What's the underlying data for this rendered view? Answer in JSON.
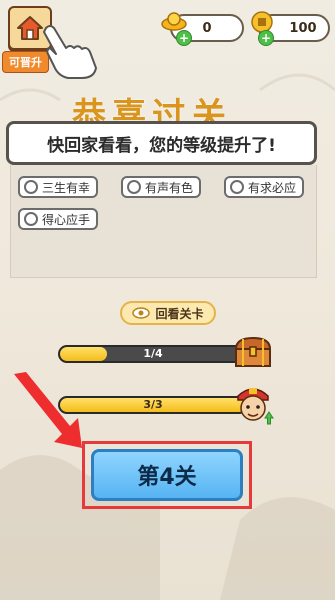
{
  "header": {
    "upgrade_badge": "可晋升",
    "currency_a": {
      "icon": "gold-ingot-icon",
      "value": "0"
    },
    "currency_b": {
      "icon": "coin-icon",
      "value": "100"
    }
  },
  "title_partial": "恭喜过关",
  "banner_text": "快回家看看，您的等级提升了!",
  "tags": [
    {
      "label": "三生有幸"
    },
    {
      "label": "有声有色"
    },
    {
      "label": "有求必应"
    },
    {
      "label": "得心应手"
    }
  ],
  "review_button": {
    "label": "回看关卡",
    "icon": "eye-icon"
  },
  "progress": [
    {
      "label": "1/4",
      "fraction": 0.25,
      "reward_icon": "treasure-chest-icon"
    },
    {
      "label": "3/3",
      "fraction": 1.0,
      "reward_icon": "character-upgrade-icon"
    }
  ],
  "level_button": {
    "label": "第4关"
  },
  "colors": {
    "accent_orange": "#f08a2c",
    "progress_yellow": "#f5bd1a",
    "button_blue": "#56b4f2",
    "highlight_red": "#e6393b"
  }
}
